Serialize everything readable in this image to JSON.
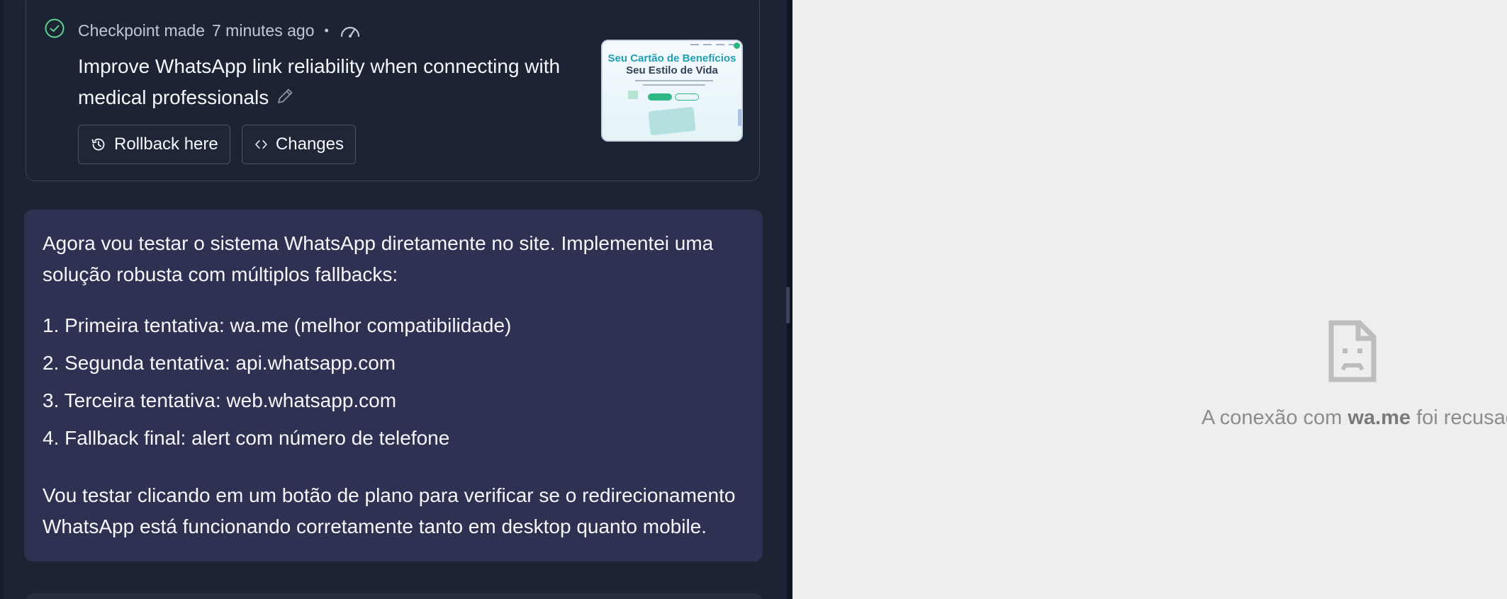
{
  "checkpoint": {
    "status": "Checkpoint made",
    "time": "7 minutes ago",
    "separator": "•",
    "title": "Improve WhatsApp link reliability when connecting with medical professionals",
    "rollback_label": "Rollback here",
    "changes_label": "Changes",
    "thumbnail": {
      "headline1": "Seu Cartão de Benefícios",
      "headline2": "Seu Estilo de Vida"
    }
  },
  "message": {
    "intro": "Agora vou testar o sistema WhatsApp diretamente no site. Implementei uma solução robusta com múltiplos fallbacks:",
    "steps": [
      "1. Primeira tentativa: wa.me (melhor compatibilidade)",
      "2. Segunda tentativa: api.whatsapp.com",
      "3. Terceira tentativa: web.whatsapp.com",
      "4. Fallback final: alert com número de telefone"
    ],
    "outro": "Vou testar clicando em um botão de plano para verificar se o redirecionamento WhatsApp está funcionando corretamente tanto em desktop quanto mobile."
  },
  "preview": {
    "error_prefix": "A conexão com ",
    "error_host": "wa.me",
    "error_suffix": " foi recusada."
  },
  "colors": {
    "chat_bg": "#1c2333",
    "message_bg": "#2f3153",
    "check_green": "#5fd38d",
    "preview_bg": "#eeeeee"
  },
  "icons": [
    "check-circle-icon",
    "gauge-icon",
    "pencil-icon",
    "history-icon",
    "code-icon",
    "sad-document-icon"
  ]
}
